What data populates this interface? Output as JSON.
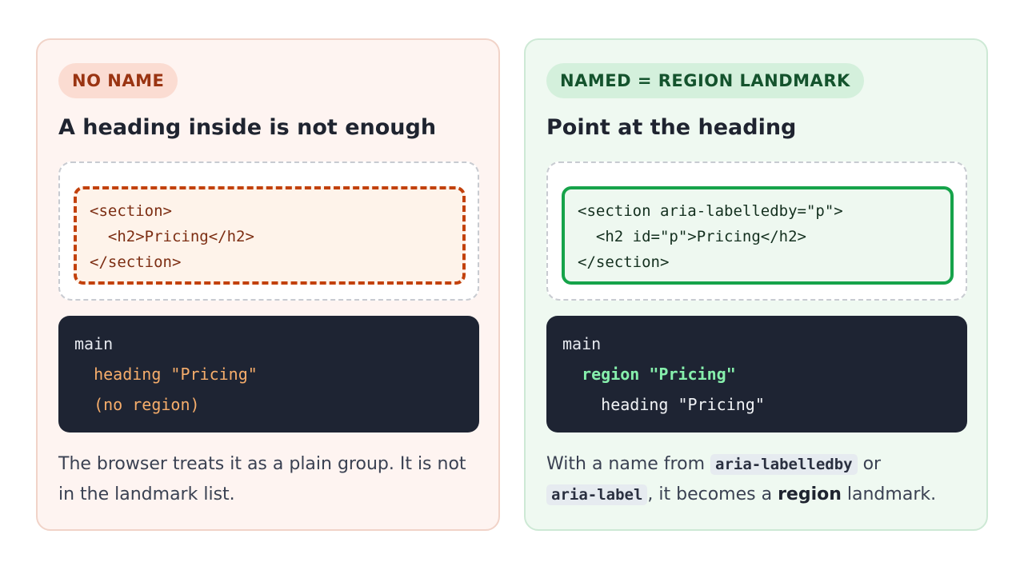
{
  "left_card": {
    "badge": "NO NAME",
    "title": "A heading inside is not enough",
    "code_lines": [
      "<section>",
      "  <h2>Pricing</h2>",
      "</section>"
    ],
    "tree_lines": [
      "main",
      "  heading \"Pricing\"",
      "  (no region)"
    ],
    "description": "The browser treats it as a plain group. It is not in the landmark list."
  },
  "right_card": {
    "badge": "NAMED = REGION LANDMARK",
    "title": "Point at the heading",
    "code_lines": [
      "<section aria-labelledby=\"p\">",
      "  <h2 id=\"p\">Pricing</h2>",
      "</section>"
    ],
    "tree_lines": [
      "main",
      "  region \"Pricing\"",
      "    heading \"Pricing\""
    ],
    "description": {
      "part1": "With a name from ",
      "code1": "aria-labelledby",
      "part2": " or ",
      "code2": "aria-label",
      "part3": ", it becomes a ",
      "bold": "region",
      "part4": " landmark."
    }
  }
}
